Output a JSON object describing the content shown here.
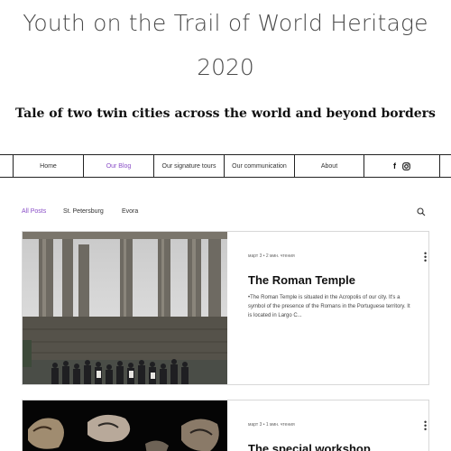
{
  "header": {
    "title": "Youth on the Trail of World Heritage",
    "year": "2020",
    "tagline": "Tale of two twin cities across the world and beyond borders"
  },
  "nav": {
    "items": [
      {
        "label": "Home"
      },
      {
        "label": "Our Blog",
        "active": true
      },
      {
        "label": "Our signature tours"
      },
      {
        "label": "Our communication"
      },
      {
        "label": "About"
      }
    ],
    "social": [
      "facebook-icon",
      "instagram-icon"
    ]
  },
  "blog": {
    "filters": [
      {
        "label": "All Posts",
        "active": true
      },
      {
        "label": "St. Petersburg"
      },
      {
        "label": "Evora"
      }
    ],
    "search_icon": "search-icon"
  },
  "posts": [
    {
      "meta": "март 3  •  2 мин. чтения",
      "title": "The Roman Temple",
      "excerpt": "•The Roman Temple is situated in the Acropolis of our city. It's a symbol of the presence of the Romans in the Portuguese territory. It is located in Largo C..."
    },
    {
      "meta": "март 3  •  1 мин. чтения",
      "title": "The special workshop"
    }
  ],
  "colors": {
    "accent": "#8a4fc7",
    "text": "#222222",
    "border": "#d8d8d8"
  }
}
